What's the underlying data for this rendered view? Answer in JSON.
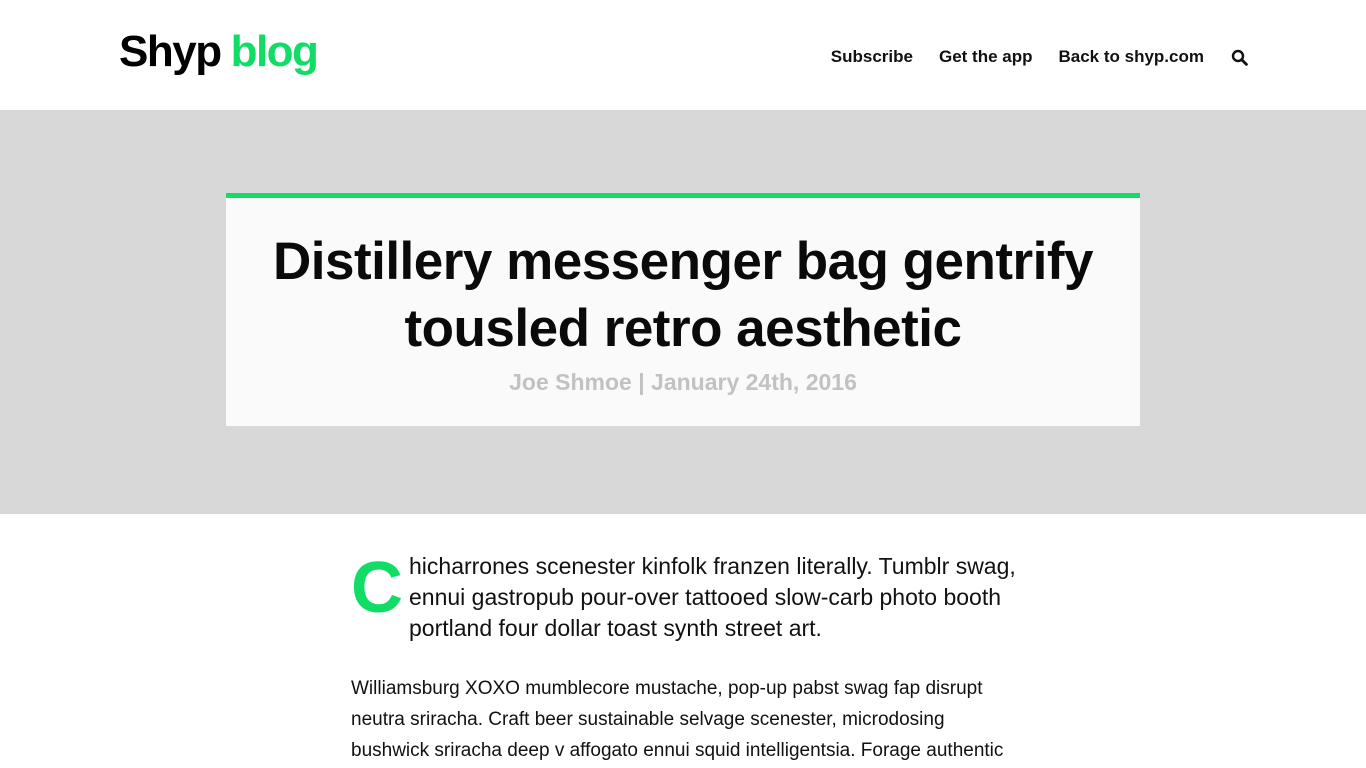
{
  "header": {
    "logo_brand": "Shyp",
    "logo_blog": "blog",
    "nav": {
      "subscribe": "Subscribe",
      "get_app": "Get the app",
      "back": "Back to shyp.com"
    },
    "search_icon": "search-icon"
  },
  "post": {
    "title": "Distillery messenger bag gentrify tousled retro aesthetic",
    "meta": "Joe Shmoe | January 24th, 2016",
    "drop_cap": "C",
    "lead_rest": "hicharrones scenester kinfolk franzen literally. Tumblr swag, ennui gastropub pour-over tattooed slow-carb photo booth portland four dollar toast synth street art.",
    "paragraph_1": "Williamsburg XOXO mumblecore mustache, pop-up pabst swag fap disrupt neutra sriracha. Craft beer sustainable selvage scenester, microdosing bushwick sriracha deep v affogato ennui squid intelligentsia. Forage authentic"
  },
  "colors": {
    "accent": "#11dd66",
    "hero_bg": "#d8d8d8",
    "card_bg": "#fafafa",
    "meta_text": "#c2c2c2"
  }
}
